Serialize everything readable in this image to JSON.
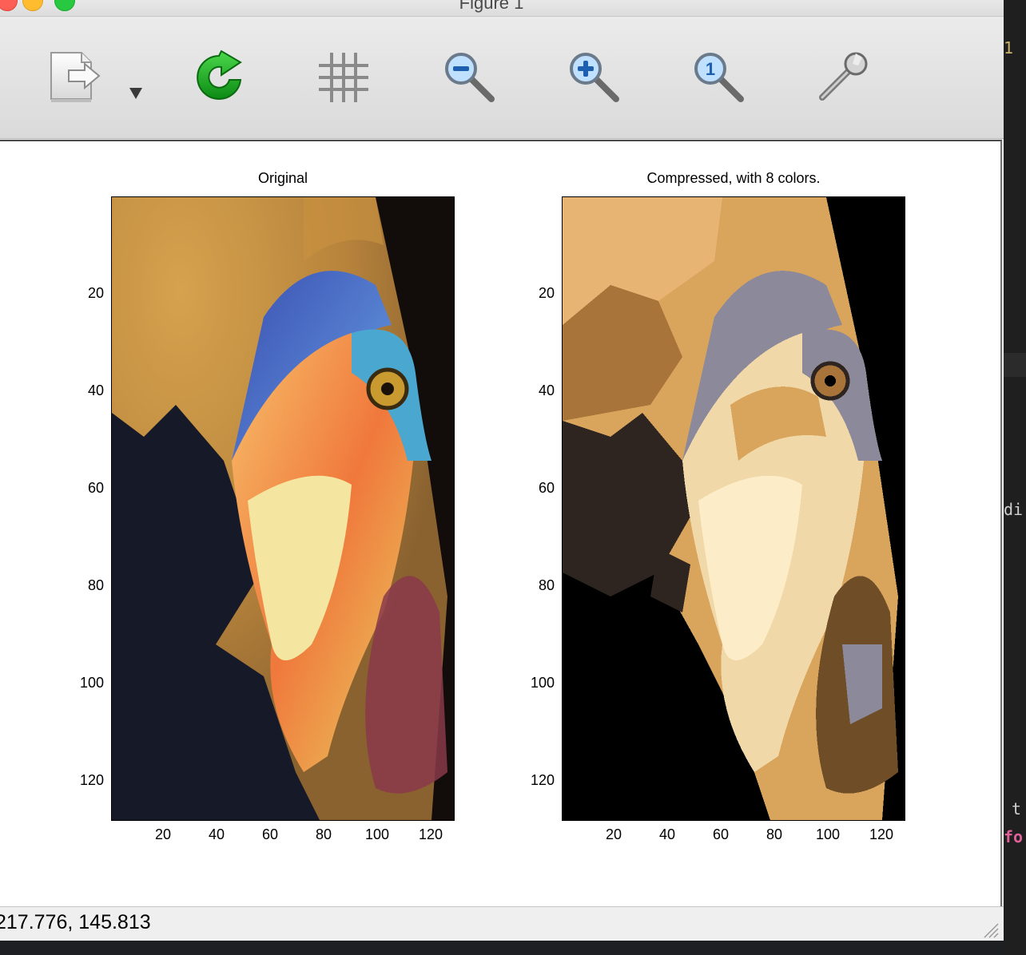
{
  "window": {
    "title": "Figure 1"
  },
  "toolbar": {
    "tools": [
      {
        "name": "export-tool",
        "icon": "export-document-icon"
      },
      {
        "name": "export-dropdown",
        "icon": "triangle-down-icon"
      },
      {
        "name": "refresh-tool",
        "icon": "green-refresh-icon"
      },
      {
        "name": "grid-tool",
        "icon": "grid-icon"
      },
      {
        "name": "zoom-out-tool",
        "icon": "zoom-out-icon"
      },
      {
        "name": "zoom-in-tool",
        "icon": "zoom-in-icon"
      },
      {
        "name": "zoom-reset-tool",
        "icon": "zoom-original-icon"
      },
      {
        "name": "settings-tool",
        "icon": "wrench-icon"
      }
    ]
  },
  "plots": [
    {
      "title": "Original",
      "image": "color photo of a hornbill head (feathers, blue eye ring, yellow-orange beak)",
      "yticks": [
        "20",
        "40",
        "60",
        "80",
        "100",
        "120"
      ],
      "xticks": [
        "20",
        "40",
        "60",
        "80",
        "100",
        "120"
      ]
    },
    {
      "title": "Compressed, with 8 colors.",
      "image": "same hornbill photo quantized to 8 colors",
      "yticks": [
        "20",
        "40",
        "60",
        "80",
        "100",
        "120"
      ],
      "xticks": [
        "20",
        "40",
        "60",
        "80",
        "100",
        "120"
      ]
    }
  ],
  "palette": {
    "compressed_colors": [
      "#000000",
      "#2e2520",
      "#6e4d27",
      "#a8743a",
      "#d9a45c",
      "#f0d8a8",
      "#fcecc8",
      "#8c8a9a"
    ]
  },
  "status": {
    "coordinates": "217.776,  145.813"
  },
  "editor_fragments": {
    "line_number": "1",
    "text1": "di",
    "text2": "t",
    "text3": "fo"
  }
}
